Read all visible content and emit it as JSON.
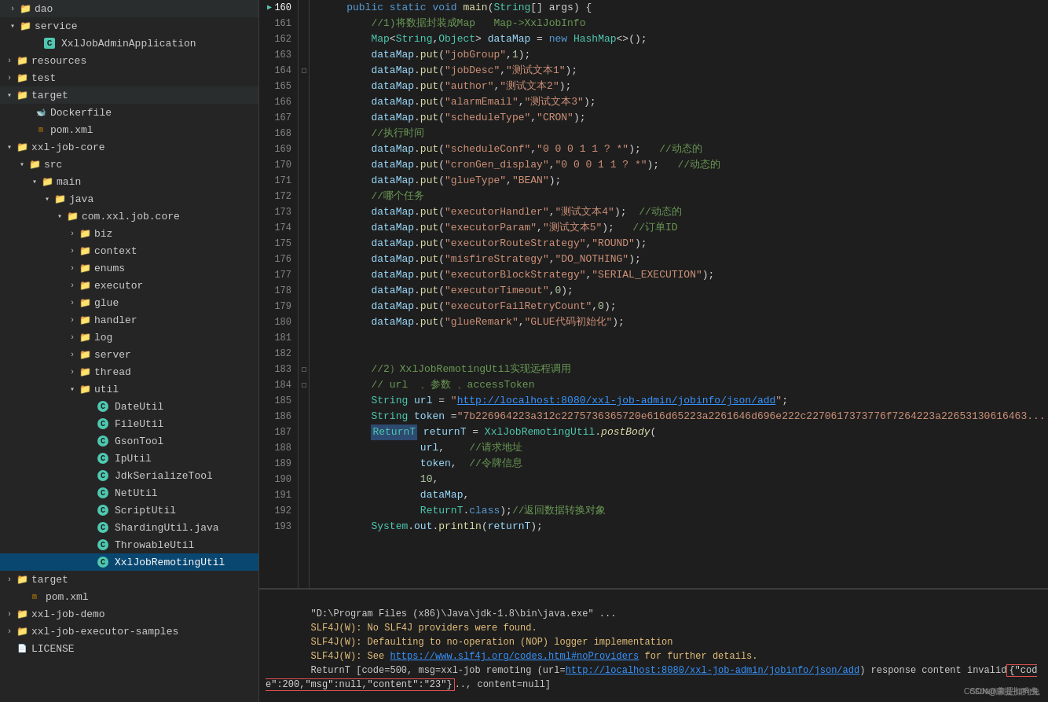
{
  "sidebar": {
    "items": [
      {
        "id": "dao",
        "label": "dao",
        "level": 1,
        "type": "folder",
        "expanded": false
      },
      {
        "id": "service",
        "label": "service",
        "level": 1,
        "type": "folder",
        "expanded": true
      },
      {
        "id": "XxlJobAdminApplication",
        "label": "XxlJobAdminApplication",
        "level": 2,
        "type": "java"
      },
      {
        "id": "resources",
        "label": "resources",
        "level": 0,
        "type": "folder-blue",
        "expanded": false
      },
      {
        "id": "test",
        "label": "test",
        "level": 0,
        "type": "folder",
        "expanded": false
      },
      {
        "id": "target",
        "label": "target",
        "level": 0,
        "type": "folder-orange",
        "expanded": true
      },
      {
        "id": "Dockerfile",
        "label": "Dockerfile",
        "level": 1,
        "type": "docker"
      },
      {
        "id": "pom1",
        "label": "pom.xml",
        "level": 1,
        "type": "xml"
      },
      {
        "id": "xxl-job-core",
        "label": "xxl-job-core",
        "level": 0,
        "type": "folder",
        "expanded": true
      },
      {
        "id": "src",
        "label": "src",
        "level": 1,
        "type": "folder",
        "expanded": true
      },
      {
        "id": "main",
        "label": "main",
        "level": 2,
        "type": "folder",
        "expanded": true
      },
      {
        "id": "java",
        "label": "java",
        "level": 3,
        "type": "folder",
        "expanded": true
      },
      {
        "id": "com.xxl.job.core",
        "label": "com.xxl.job.core",
        "level": 4,
        "type": "folder",
        "expanded": true
      },
      {
        "id": "biz",
        "label": "biz",
        "level": 5,
        "type": "folder",
        "expanded": false
      },
      {
        "id": "context",
        "label": "context",
        "level": 5,
        "type": "folder",
        "expanded": false
      },
      {
        "id": "enums",
        "label": "enums",
        "level": 5,
        "type": "folder",
        "expanded": false
      },
      {
        "id": "executor",
        "label": "executor",
        "level": 5,
        "type": "folder",
        "expanded": false
      },
      {
        "id": "glue",
        "label": "glue",
        "level": 5,
        "type": "folder",
        "expanded": false
      },
      {
        "id": "handler",
        "label": "handler",
        "level": 5,
        "type": "folder",
        "expanded": false
      },
      {
        "id": "log",
        "label": "log",
        "level": 5,
        "type": "folder",
        "expanded": false
      },
      {
        "id": "server",
        "label": "server",
        "level": 5,
        "type": "folder",
        "expanded": false
      },
      {
        "id": "thread",
        "label": "thread",
        "level": 5,
        "type": "folder",
        "expanded": false
      },
      {
        "id": "util",
        "label": "util",
        "level": 5,
        "type": "folder",
        "expanded": true
      },
      {
        "id": "DateUtil",
        "label": "DateUtil",
        "level": 6,
        "type": "java"
      },
      {
        "id": "FileUtil",
        "label": "FileUtil",
        "level": 6,
        "type": "java"
      },
      {
        "id": "GsonTool",
        "label": "GsonTool",
        "level": 6,
        "type": "java"
      },
      {
        "id": "IpUtil",
        "label": "IpUtil",
        "level": 6,
        "type": "java"
      },
      {
        "id": "JdkSerializeTool",
        "label": "JdkSerializeTool",
        "level": 6,
        "type": "java"
      },
      {
        "id": "NetUtil",
        "label": "NetUtil",
        "level": 6,
        "type": "java"
      },
      {
        "id": "ScriptUtil",
        "label": "ScriptUtil",
        "level": 6,
        "type": "java"
      },
      {
        "id": "ShardingUtil",
        "label": "ShardingUtil.java",
        "level": 6,
        "type": "java"
      },
      {
        "id": "ThrowableUtil",
        "label": "ThrowableUtil",
        "level": 6,
        "type": "java"
      },
      {
        "id": "XxlJobRemotingUtil",
        "label": "XxlJobRemotingUtil",
        "level": 6,
        "type": "java",
        "selected": true
      },
      {
        "id": "target2",
        "label": "target",
        "level": 0,
        "type": "folder",
        "expanded": false
      },
      {
        "id": "pom2",
        "label": "pom.xml",
        "level": 1,
        "type": "xml"
      },
      {
        "id": "xxl-job-demo",
        "label": "xxl-job-demo",
        "level": 0,
        "type": "folder",
        "expanded": false
      },
      {
        "id": "xxl-job-executor-samples",
        "label": "xxl-job-executor-samples",
        "level": 0,
        "type": "folder",
        "expanded": false
      },
      {
        "id": "LICENSE",
        "label": "LICENSE",
        "level": 0,
        "type": "license"
      }
    ]
  },
  "code": {
    "lines": [
      {
        "num": 160,
        "content": "    public static void main(String[] args) {",
        "debug": true
      },
      {
        "num": 161,
        "content": "        //1)将数据封装成Map   Map->XxlJobInfo"
      },
      {
        "num": 162,
        "content": "        Map<String,Object> dataMap = new HashMap<>();"
      },
      {
        "num": 163,
        "content": "        dataMap.put(\"jobGroup\",1);"
      },
      {
        "num": 164,
        "content": "        dataMap.put(\"jobDesc\",\"测试文本1\");"
      },
      {
        "num": 165,
        "content": "        dataMap.put(\"author\",\"测试文本2\");"
      },
      {
        "num": 166,
        "content": "        dataMap.put(\"alarmEmail\",\"测试文本3\");"
      },
      {
        "num": 167,
        "content": "        dataMap.put(\"scheduleType\",\"CRON\");"
      },
      {
        "num": 168,
        "content": "        //执行时间"
      },
      {
        "num": 169,
        "content": "        dataMap.put(\"scheduleConf\",\"0 0 0 1 1 ? *\");   //动态的"
      },
      {
        "num": 170,
        "content": "        dataMap.put(\"cronGen_display\",\"0 0 0 1 1 ? *\");   //动态的"
      },
      {
        "num": 171,
        "content": "        dataMap.put(\"glueType\",\"BEAN\");"
      },
      {
        "num": 172,
        "content": "        //哪个任务"
      },
      {
        "num": 173,
        "content": "        dataMap.put(\"executorHandler\",\"测试文本4\");  //动态的"
      },
      {
        "num": 174,
        "content": "        dataMap.put(\"executorParam\",\"测试文本5\");   //订单ID"
      },
      {
        "num": 175,
        "content": "        dataMap.put(\"executorRouteStrategy\",\"ROUND\");"
      },
      {
        "num": 176,
        "content": "        dataMap.put(\"misfireStrategy\",\"DO_NOTHING\");"
      },
      {
        "num": 177,
        "content": "        dataMap.put(\"executorBlockStrategy\",\"SERIAL_EXECUTION\");"
      },
      {
        "num": 178,
        "content": "        dataMap.put(\"executorTimeout\",0);"
      },
      {
        "num": 179,
        "content": "        dataMap.put(\"executorFailRetryCount\",0);"
      },
      {
        "num": 180,
        "content": "        dataMap.put(\"glueRemark\",\"GLUE代码初始化\");"
      },
      {
        "num": 181,
        "content": ""
      },
      {
        "num": 182,
        "content": ""
      },
      {
        "num": 183,
        "content": "        //2）XxlJobRemotingUtil实现远程调用"
      },
      {
        "num": 184,
        "content": "        // url  、参数 、accessToken"
      },
      {
        "num": 185,
        "content": "        String url = \"http://localhost:8080/xxl-job-admin/jobinfo/json/add\";"
      },
      {
        "num": 186,
        "content": "        String token =\"7b226964223a312c2275736365720e616d65223a2261646d696e222c2270617373776f7264223a22653130616463..."
      },
      {
        "num": 187,
        "content": "        ReturnT returnT = XxlJobRemotingUtil.postBody("
      },
      {
        "num": 188,
        "content": "                url,    //请求地址"
      },
      {
        "num": 189,
        "content": "                token,  //令牌信息"
      },
      {
        "num": 190,
        "content": "                10,"
      },
      {
        "num": 191,
        "content": "                dataMap,"
      },
      {
        "num": 192,
        "content": "                ReturnT.class);//返回数据转换对象"
      },
      {
        "num": 193,
        "content": "        System.out.println(returnT);"
      }
    ]
  },
  "console": {
    "lines": [
      {
        "type": "cmd",
        "text": "\"D:\\Program Files (x86)\\Java\\jdk-1.8\\bin\\java.exe\" ..."
      },
      {
        "type": "warning",
        "text": "SLF4J(W): No SLF4J providers were found."
      },
      {
        "type": "warning",
        "text": "SLF4J(W): Defaulting to no-operation (NOP) logger implementation"
      },
      {
        "type": "warning",
        "text": "SLF4J(W): See https://www.slf4j.org/codes.html#noProviders for further details."
      },
      {
        "type": "result",
        "text": "ReturnT [code=500, msg=xxl-job remoting (url=http://localhost:8080/xxl-job-admin/jobinfo/json/add) response content invalid{\"code\":200,\"msg\":null,\"content\":\"23\"}.., content=null]"
      }
    ]
  },
  "watermark": "CSDN@康提扣狗兔"
}
